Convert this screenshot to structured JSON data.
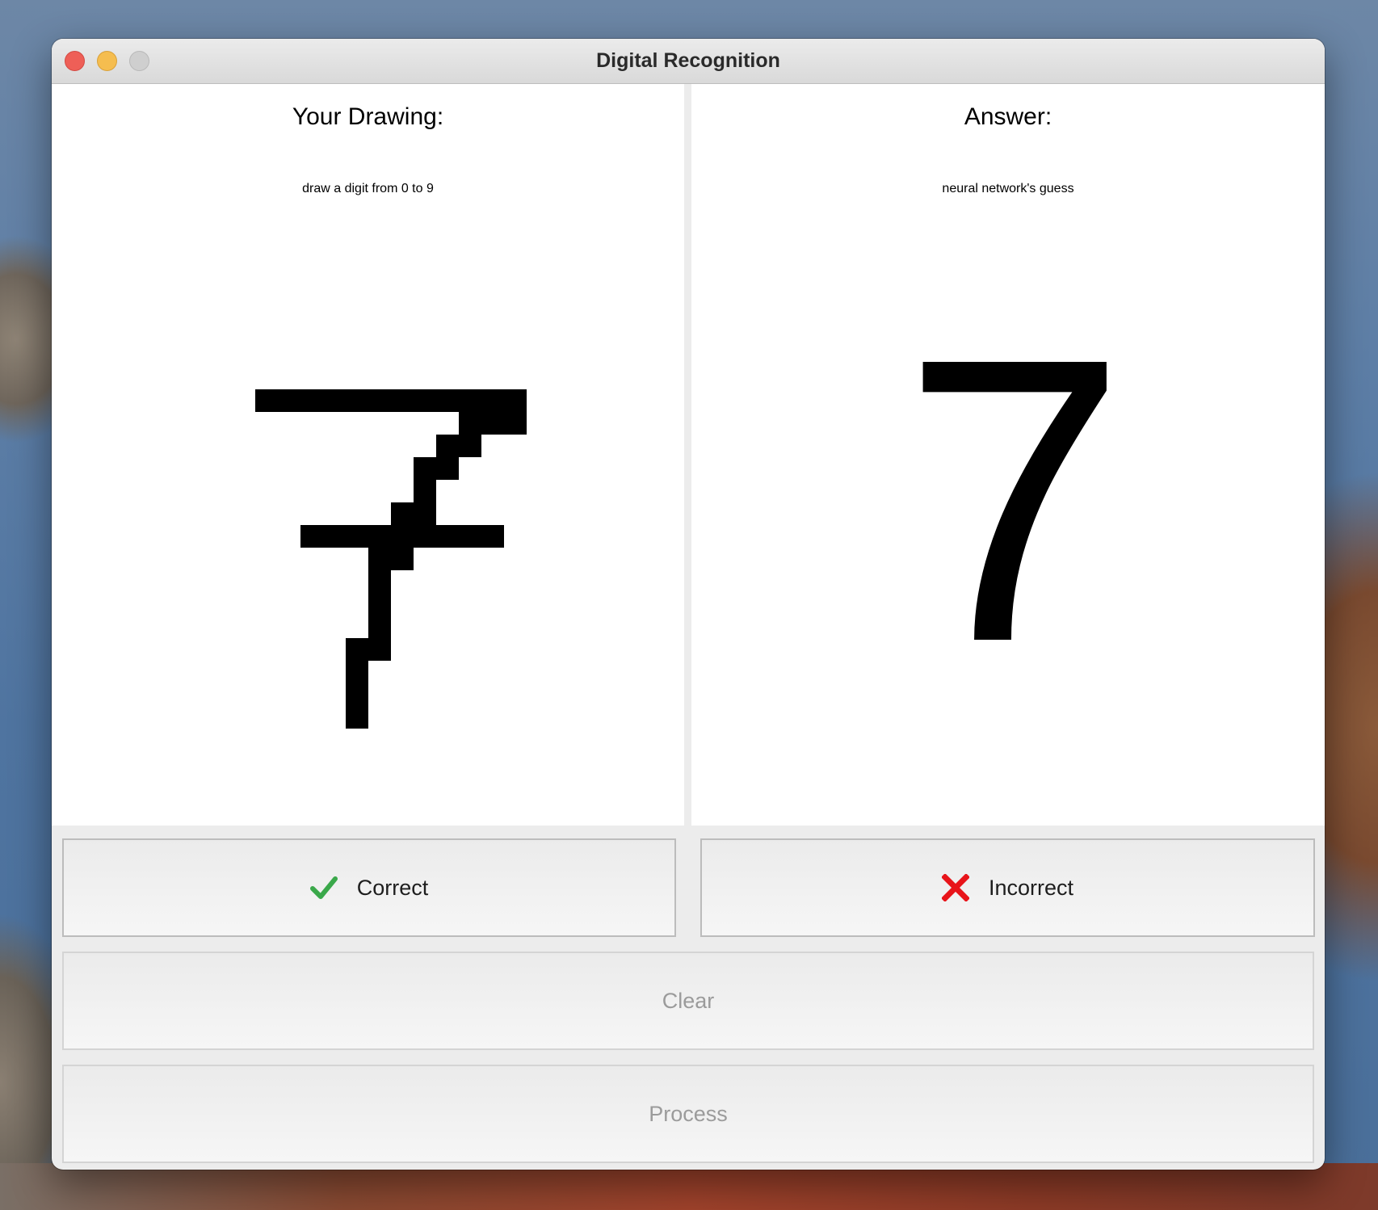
{
  "window": {
    "title": "Digital Recognition"
  },
  "left_panel": {
    "heading": "Your Drawing:",
    "subheading": "draw a digit from 0 to 9"
  },
  "right_panel": {
    "heading": "Answer:",
    "subheading": "neural network's guess",
    "predicted_digit": "7"
  },
  "buttons": {
    "correct_label": "Correct",
    "correct_icon": "checkmark-icon",
    "correct_icon_color": "#3aa84a",
    "incorrect_label": "Incorrect",
    "incorrect_icon": "x-mark-icon",
    "incorrect_icon_color": "#e8141a",
    "clear_label": "Clear",
    "process_label": "Process"
  }
}
